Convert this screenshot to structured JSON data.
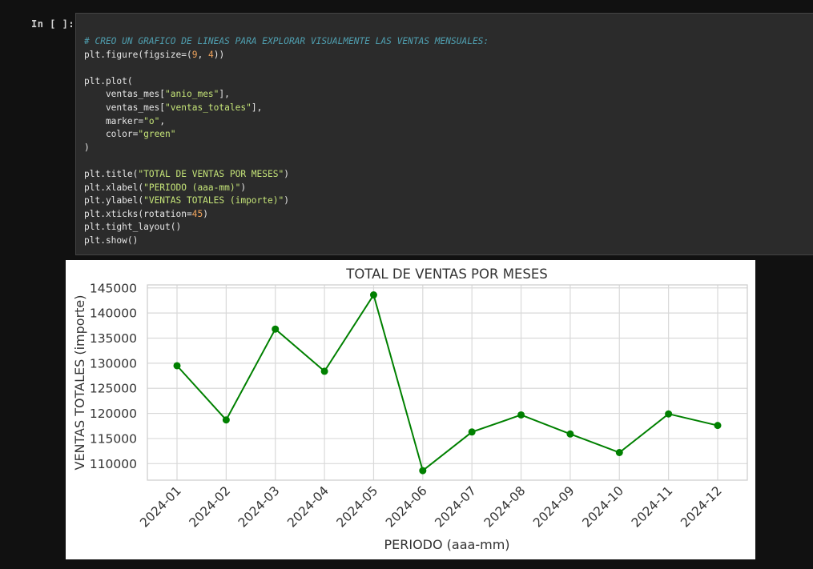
{
  "cell": {
    "prompt": "In [ ]:",
    "code_lines": [
      {
        "parts": [
          {
            "t": "# CREO UN GRAFICO DE LINEAS PARA EXPLORAR VISUALMENTE LAS VENTAS MENSUALES:",
            "c": "comment"
          }
        ]
      },
      {
        "parts": [
          {
            "t": "plt.figure(figsize=(",
            "c": ""
          },
          {
            "t": "9",
            "c": "num"
          },
          {
            "t": ", ",
            "c": ""
          },
          {
            "t": "4",
            "c": "num"
          },
          {
            "t": "))",
            "c": ""
          }
        ]
      },
      {
        "parts": []
      },
      {
        "parts": [
          {
            "t": "plt.plot(",
            "c": ""
          }
        ]
      },
      {
        "parts": [
          {
            "t": "    ventas_mes[",
            "c": ""
          },
          {
            "t": "\"anio_mes\"",
            "c": "str"
          },
          {
            "t": "],",
            "c": ""
          }
        ]
      },
      {
        "parts": [
          {
            "t": "    ventas_mes[",
            "c": ""
          },
          {
            "t": "\"ventas_totales\"",
            "c": "str"
          },
          {
            "t": "],",
            "c": ""
          }
        ]
      },
      {
        "parts": [
          {
            "t": "    marker=",
            "c": ""
          },
          {
            "t": "\"o\"",
            "c": "str"
          },
          {
            "t": ",",
            "c": ""
          }
        ]
      },
      {
        "parts": [
          {
            "t": "    color=",
            "c": ""
          },
          {
            "t": "\"green\"",
            "c": "str"
          }
        ]
      },
      {
        "parts": [
          {
            "t": ")",
            "c": ""
          }
        ]
      },
      {
        "parts": []
      },
      {
        "parts": [
          {
            "t": "plt.title(",
            "c": ""
          },
          {
            "t": "\"TOTAL DE VENTAS POR MESES\"",
            "c": "str"
          },
          {
            "t": ")",
            "c": ""
          }
        ]
      },
      {
        "parts": [
          {
            "t": "plt.xlabel(",
            "c": ""
          },
          {
            "t": "\"PERIODO (aaa-mm)\"",
            "c": "str"
          },
          {
            "t": ")",
            "c": ""
          }
        ]
      },
      {
        "parts": [
          {
            "t": "plt.ylabel(",
            "c": ""
          },
          {
            "t": "\"VENTAS TOTALES (importe)\"",
            "c": "str"
          },
          {
            "t": ")",
            "c": ""
          }
        ]
      },
      {
        "parts": [
          {
            "t": "plt.xticks(rotation=",
            "c": ""
          },
          {
            "t": "45",
            "c": "num"
          },
          {
            "t": ")",
            "c": ""
          }
        ]
      },
      {
        "parts": [
          {
            "t": "plt.tight_layout()",
            "c": ""
          }
        ]
      },
      {
        "parts": [
          {
            "t": "plt.show()",
            "c": ""
          }
        ]
      }
    ]
  },
  "colors": {
    "line": "#008000",
    "grid": "#d9d9d9",
    "axis_text": "#333333"
  },
  "chart_data": {
    "type": "line",
    "title": "TOTAL DE VENTAS POR MESES",
    "xlabel": "PERIODO (aaa-mm)",
    "ylabel": "VENTAS TOTALES (importe)",
    "categories": [
      "2024-01",
      "2024-02",
      "2024-03",
      "2024-04",
      "2024-05",
      "2024-06",
      "2024-07",
      "2024-08",
      "2024-09",
      "2024-10",
      "2024-11",
      "2024-12"
    ],
    "values": [
      129500,
      118700,
      136800,
      128400,
      143600,
      108600,
      116300,
      119700,
      115900,
      112200,
      119900,
      117600
    ],
    "yticks": [
      110000,
      115000,
      120000,
      125000,
      130000,
      135000,
      140000,
      145000
    ],
    "ylim": [
      106700,
      145600
    ],
    "grid": true,
    "marker": "o",
    "xtick_rotation": 45
  }
}
